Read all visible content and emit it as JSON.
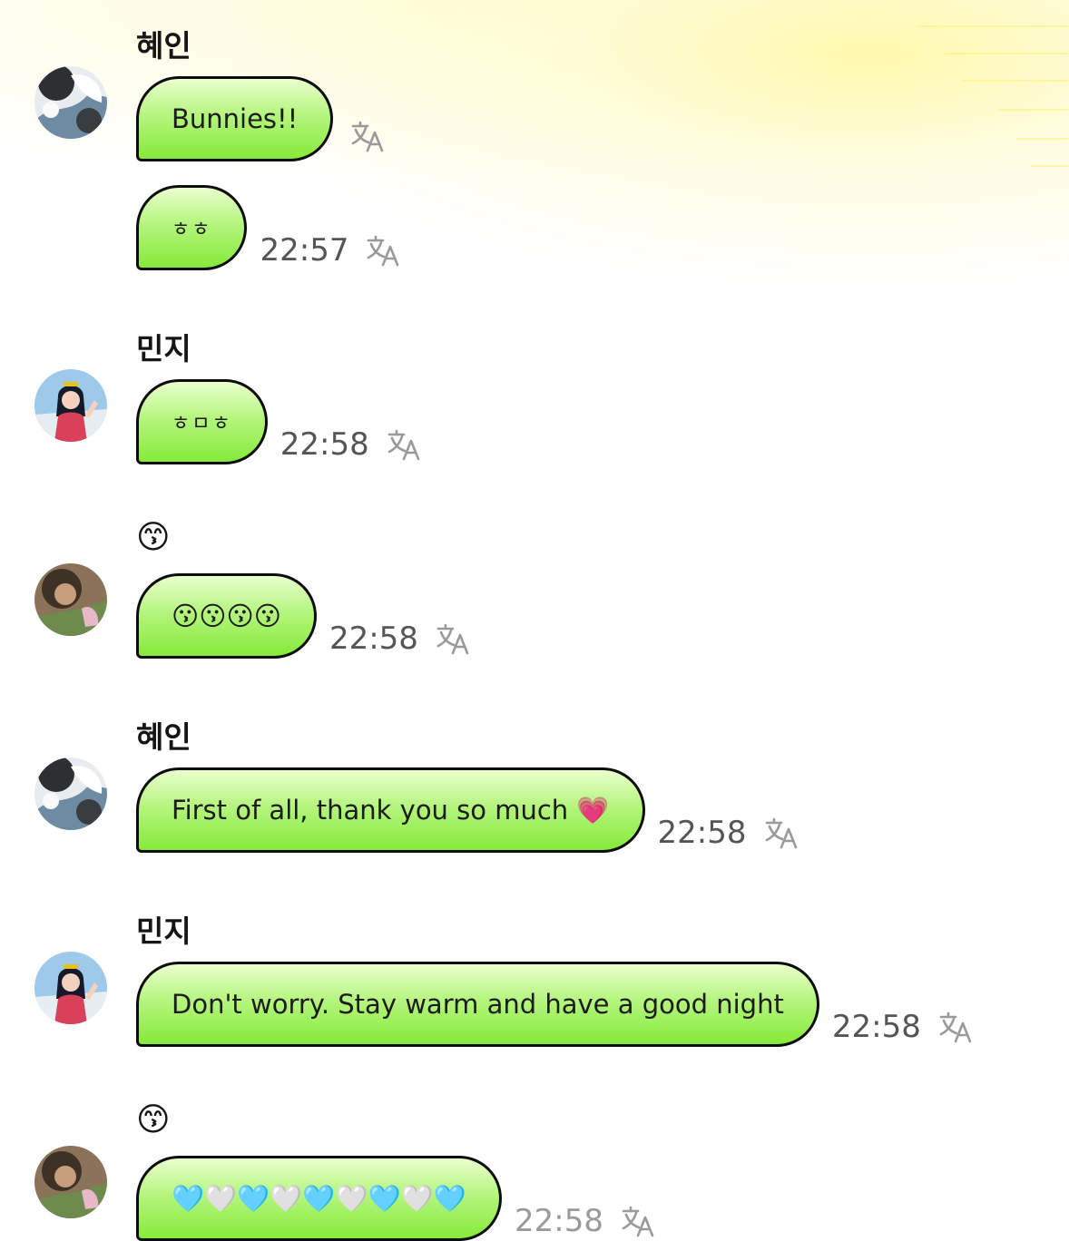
{
  "messages": [
    {
      "sender": "혜인",
      "avatar": "anime-bw-avatar",
      "bubbles": [
        {
          "text": "Bunnies!!",
          "time": ""
        },
        {
          "text": "ㅎㅎ",
          "time": "22:57"
        }
      ]
    },
    {
      "sender": "민지",
      "avatar": "anime-girl-avatar",
      "bubbles": [
        {
          "text": "ㅎㅁㅎ",
          "time": "22:58"
        }
      ]
    },
    {
      "sender": "😙",
      "avatar": "photo-avatar",
      "bubbles": [
        {
          "text": "😗😗😗😗",
          "time": "22:58"
        }
      ]
    },
    {
      "sender": "혜인",
      "avatar": "anime-bw-avatar",
      "bubbles": [
        {
          "text": "First of all, thank you so much 💗",
          "time": "22:58"
        }
      ]
    },
    {
      "sender": "민지",
      "avatar": "anime-girl-avatar",
      "bubbles": [
        {
          "text": "Don't worry. Stay warm and have a good night",
          "time": "22:58"
        }
      ]
    },
    {
      "sender": "😙",
      "avatar": "photo-avatar",
      "bubbles": [
        {
          "text": "🩵🤍🩵🤍🩵🤍🩵🤍🩵",
          "time": "22:58"
        }
      ]
    }
  ],
  "icons": {
    "translate": "translate-icon"
  },
  "colors": {
    "bubble_top": "#eaffce",
    "bubble_bottom": "#86ea3a",
    "bubble_border": "#0c0c0c",
    "time": "#555555",
    "sender": "#151515"
  }
}
